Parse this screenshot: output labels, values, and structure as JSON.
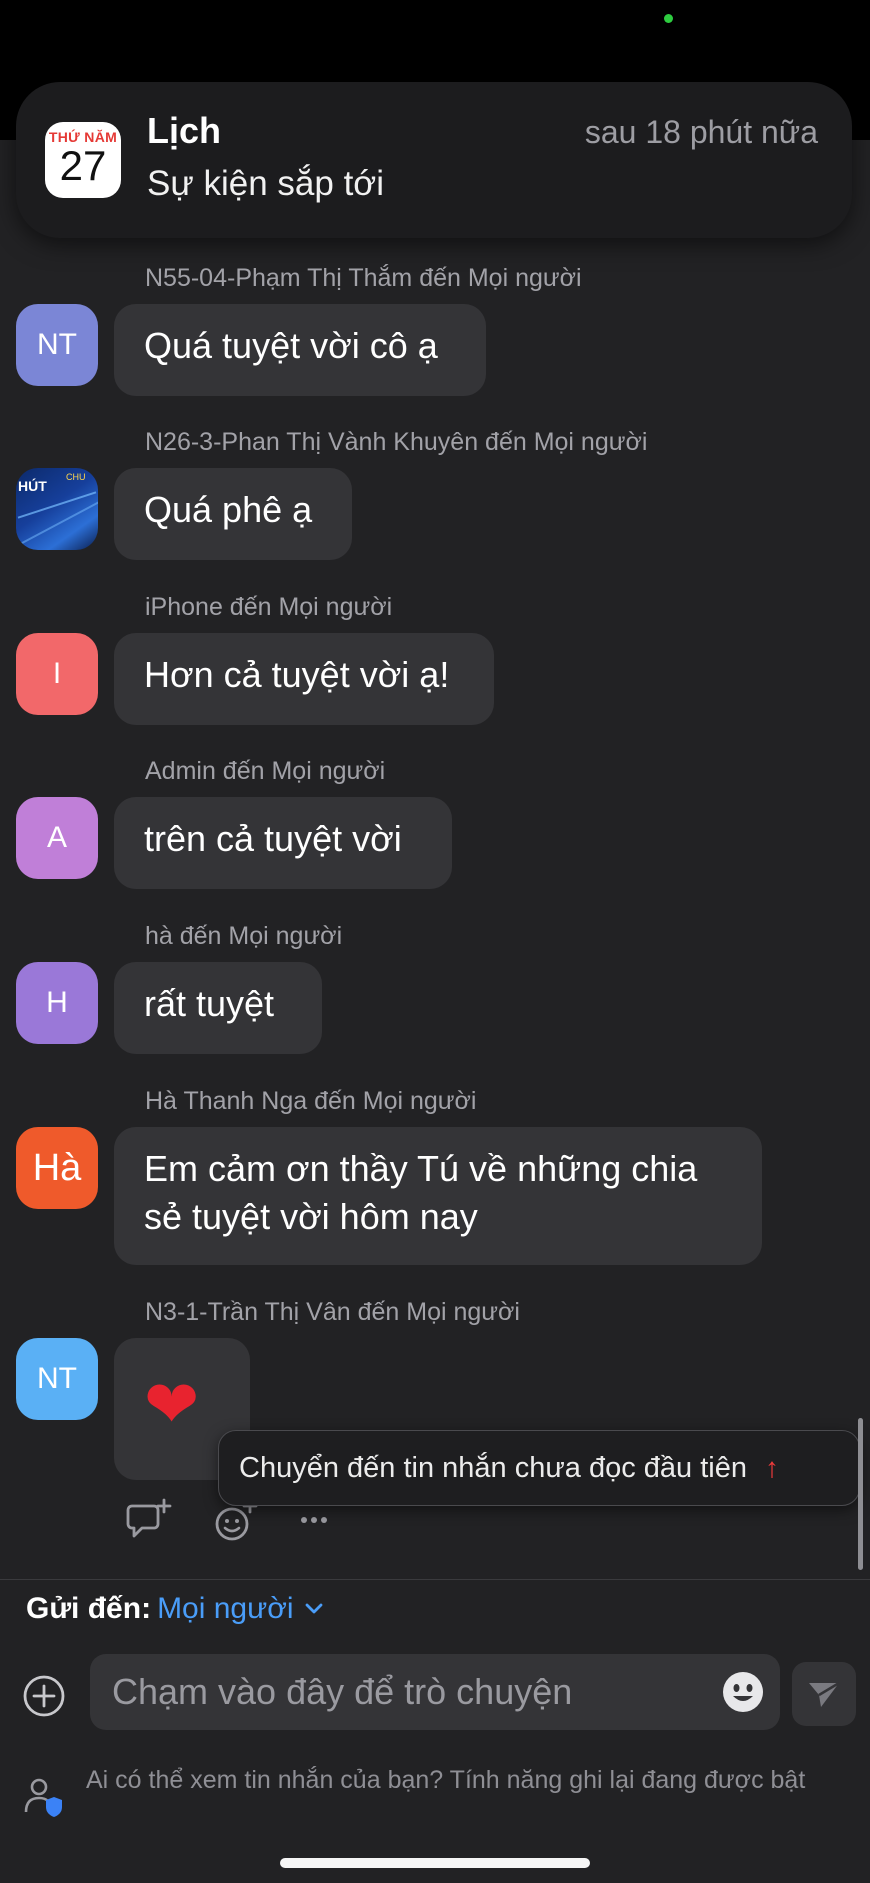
{
  "notification": {
    "calendar_day": "THỨ NĂM",
    "calendar_date": "27",
    "app_name": "Lịch",
    "body": "Sự kiện sắp tới",
    "time": "sau 18 phút nữa"
  },
  "messages": [
    {
      "sender": "N55-04-Phạm Thị Thắm đến Mọi người",
      "avatar": "NT",
      "avatar_color": "#7b86d6",
      "text": "Quá tuyệt vời cô ạ"
    },
    {
      "sender": "N26-3-Phan Thị Vành Khuyên đến Mọi người",
      "avatar_image_text_1": "HÚT",
      "avatar_image_text_2": "CHU",
      "text": "Quá phê ạ"
    },
    {
      "sender": "iPhone đến Mọi người",
      "avatar": "I",
      "avatar_color": "#f2686a",
      "text": "Hơn cả tuyệt vời ạ!"
    },
    {
      "sender": "Admin đến Mọi người",
      "avatar": "A",
      "avatar_color": "#c07fd8",
      "text": "trên cả tuyệt vời"
    },
    {
      "sender": "hà đến Mọi người",
      "avatar": "H",
      "avatar_color": "#9a78d8",
      "text": "rất tuyệt"
    },
    {
      "sender": "Hà Thanh Nga đến Mọi người",
      "avatar": "Hà",
      "avatar_color": "#ef5a2b",
      "text_line1": "Em cảm ơn thầy Tú về những chia",
      "text_line2": "sẻ tuyệt vời hôm nay"
    },
    {
      "sender": "N3-1-Trần Thị Vân đến Mọi người",
      "avatar": "NT",
      "avatar_color": "#5ab0f5",
      "text": "❤"
    }
  ],
  "jump_banner": {
    "label": "Chuyển đến tin nhắn chưa đọc đầu tiên",
    "arrow": "↑"
  },
  "actions": [
    "reply-icon",
    "add-reaction-icon",
    "more-icon"
  ],
  "send_to": {
    "label": "Gửi đến:",
    "value": "Mọi người"
  },
  "input": {
    "placeholder": "Chạm vào đây để trò chuyện"
  },
  "privacy_notice": "Ai có thể xem tin nhắn của bạn? Tính năng ghi lại đang được bật",
  "colors": {
    "background": "#222224",
    "bubble": "#343437",
    "link": "#4a9df8",
    "arrow": "#ef3b3b"
  }
}
